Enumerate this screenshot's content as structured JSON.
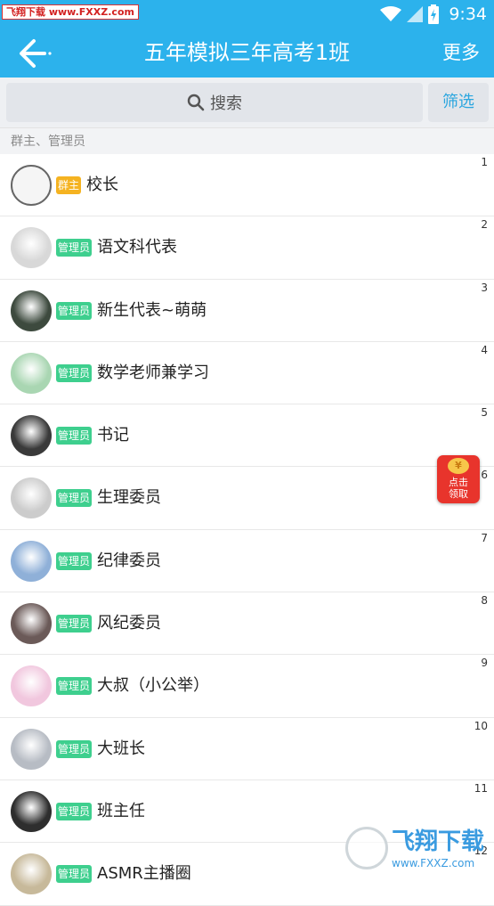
{
  "status_bar": {
    "time": "9:34",
    "watermark": "飞翔下载 www.FXXZ.com"
  },
  "header": {
    "title": "五年模拟三年高考1班",
    "more_label": "更多"
  },
  "search": {
    "placeholder": "搜索",
    "filter_label": "筛选"
  },
  "section_label": "群主、管理员",
  "members": [
    {
      "index": "1",
      "badge": "群主",
      "badge_type": "owner",
      "name": "校长",
      "avatar_color": "#f0f0f0"
    },
    {
      "index": "2",
      "badge": "管理员",
      "badge_type": "admin",
      "name": "语文科代表",
      "avatar_color": "#d8d8d8"
    },
    {
      "index": "3",
      "badge": "管理员",
      "badge_type": "admin",
      "name": "新生代表~萌萌",
      "avatar_color": "#3d4a3e"
    },
    {
      "index": "4",
      "badge": "管理员",
      "badge_type": "admin",
      "name": "数学老师兼学习",
      "avatar_color": "#a9d6b2"
    },
    {
      "index": "5",
      "badge": "管理员",
      "badge_type": "admin",
      "name": "书记",
      "avatar_color": "#3a3a3a"
    },
    {
      "index": "6",
      "badge": "管理员",
      "badge_type": "admin",
      "name": "生理委员",
      "avatar_color": "#cccccc"
    },
    {
      "index": "7",
      "badge": "管理员",
      "badge_type": "admin",
      "name": "纪律委员",
      "avatar_color": "#8fb0d8"
    },
    {
      "index": "8",
      "badge": "管理员",
      "badge_type": "admin",
      "name": "风纪委员",
      "avatar_color": "#6b5a58"
    },
    {
      "index": "9",
      "badge": "管理员",
      "badge_type": "admin",
      "name": "大叔（小公举）",
      "avatar_color": "#f1c7de"
    },
    {
      "index": "10",
      "badge": "管理员",
      "badge_type": "admin",
      "name": "大班长",
      "avatar_color": "#b7bcc4"
    },
    {
      "index": "11",
      "badge": "管理员",
      "badge_type": "admin",
      "name": "班主任",
      "avatar_color": "#2e2e2e"
    },
    {
      "index": "12",
      "badge": "管理员",
      "badge_type": "admin",
      "name": "ASMR主播圈",
      "avatar_color": "#c7b99a"
    }
  ],
  "red_envelope": {
    "line1": "点击",
    "line2": "领取"
  },
  "bottom_watermark": {
    "brand": "飞翔下载",
    "url": "www.FXXZ.com"
  },
  "colors": {
    "primary": "#2cb2ec",
    "owner_badge": "#f5b321",
    "admin_badge": "#3ecf8e"
  }
}
